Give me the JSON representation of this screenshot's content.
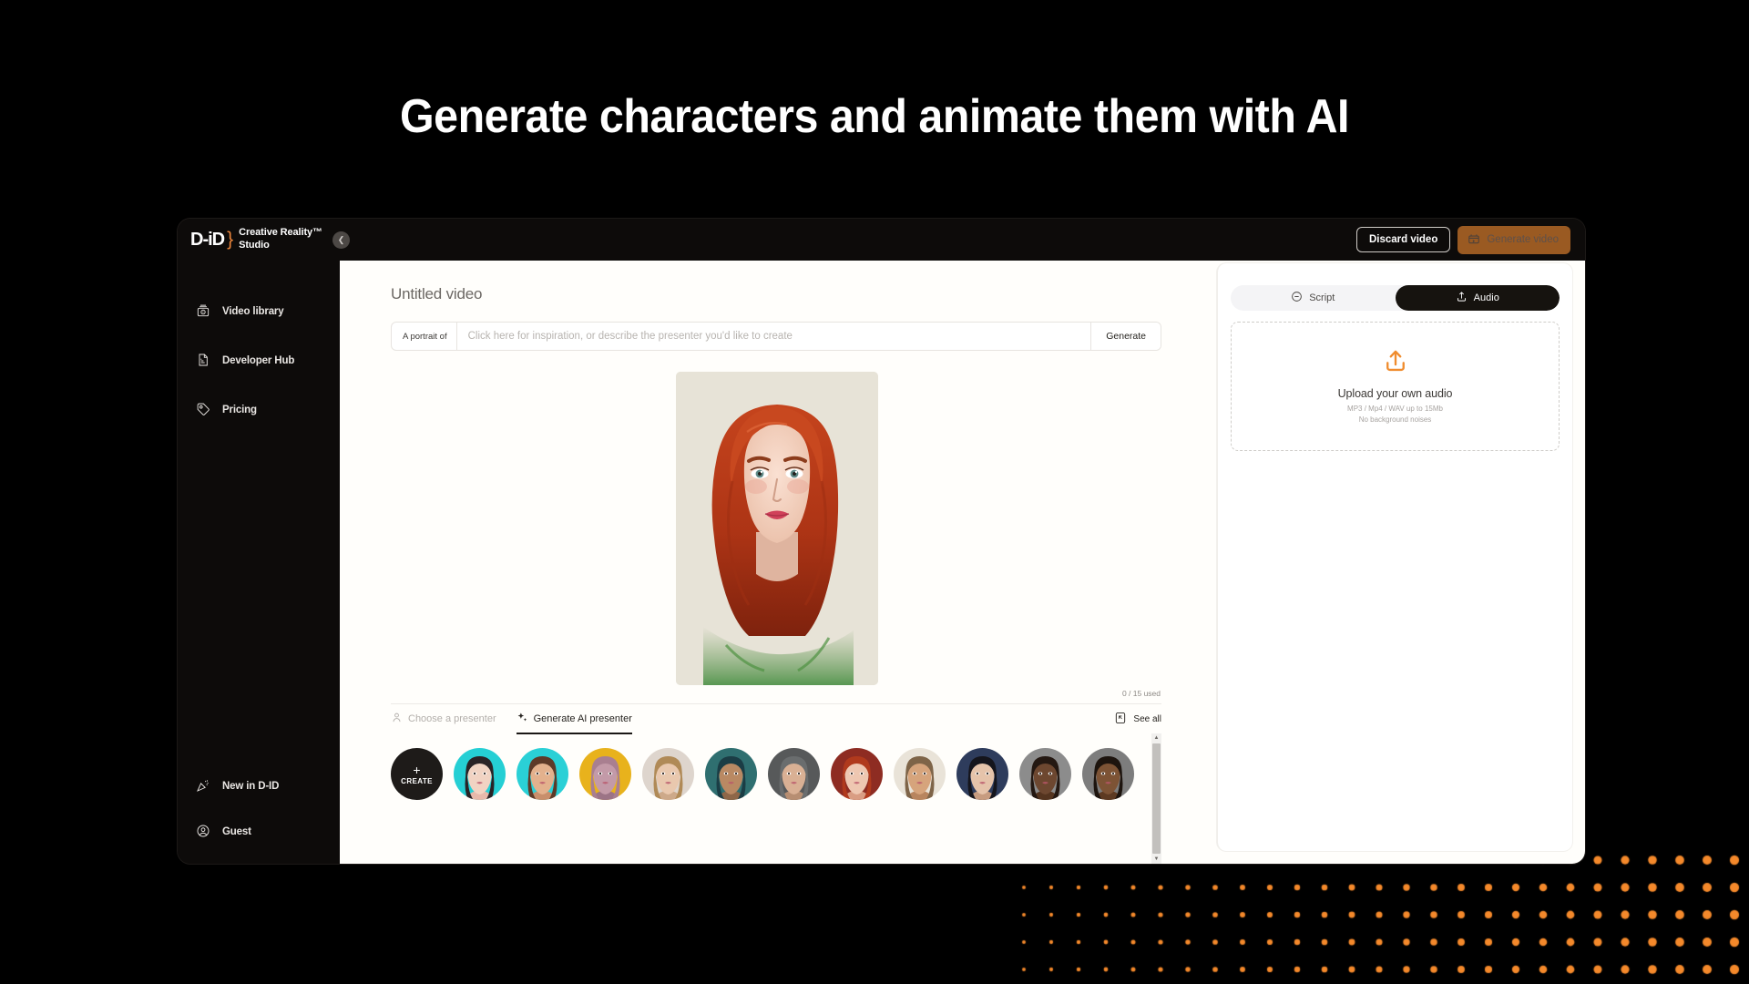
{
  "headline": "Generate characters and animate them with AI",
  "brand": {
    "logo": "D-iD",
    "title_line1": "Creative Reality™",
    "title_line2": "Studio"
  },
  "topbar": {
    "discard_label": "Discard video",
    "generate_label": "Generate video",
    "generate_icon": "video-camera-icon"
  },
  "collapse": {
    "icon": "chevron-left-icon"
  },
  "sidebar": {
    "top_items": [
      {
        "label": "Video library",
        "icon": "video-library-icon"
      },
      {
        "label": "Developer Hub",
        "icon": "document-icon"
      },
      {
        "label": "Pricing",
        "icon": "price-tag-icon"
      }
    ],
    "bottom_items": [
      {
        "label": "New in D-ID",
        "icon": "party-popper-icon"
      },
      {
        "label": "Guest",
        "icon": "user-circle-icon"
      }
    ]
  },
  "editor": {
    "video_title": "Untitled video",
    "prompt": {
      "prefix": "A portrait of",
      "value": "",
      "placeholder": "Click here for inspiration, or describe the presenter you'd like to create",
      "generate_label": "Generate"
    },
    "usage": "0 / 15 used",
    "tabs": [
      {
        "label": "Choose a presenter",
        "icon": "person-icon",
        "active": false
      },
      {
        "label": "Generate AI presenter",
        "icon": "sparkles-icon",
        "active": true
      }
    ],
    "see_all": {
      "label": "See all",
      "icon": "expand-icon"
    },
    "create_button": {
      "plus": "+",
      "label": "CREATE"
    },
    "avatars": [
      {
        "name": "avatar-woman-dark-hair",
        "bg": "#25cfd4",
        "skin": "#f1d3c3",
        "hair": "#2a2326",
        "accent": "#e7b9ab"
      },
      {
        "name": "avatar-woman-tan",
        "bg": "#2ad0d6",
        "skin": "#e3b18d",
        "hair": "#5d3a28",
        "accent": "#c88f6c"
      },
      {
        "name": "avatar-man-bald",
        "bg": "#e8b21c",
        "skin": "#c39aa8",
        "hair": "#a97f90",
        "accent": "#9c7486"
      },
      {
        "name": "avatar-man-blond",
        "bg": "#ded5cd",
        "skin": "#e9c8ae",
        "hair": "#b08a57",
        "accent": "#cda98a"
      },
      {
        "name": "avatar-woman-teal-hair",
        "bg": "#2f6f70",
        "skin": "#b98963",
        "hair": "#1b3d45",
        "accent": "#8e6748"
      },
      {
        "name": "avatar-man-glasses",
        "bg": "#57595a",
        "skin": "#d9b094",
        "hair": "#6a6d6e",
        "accent": "#b78e72"
      },
      {
        "name": "avatar-woman-red-hair",
        "bg": "#8e2c22",
        "skin": "#eec7b1",
        "hair": "#b03a1d",
        "accent": "#d99d83"
      },
      {
        "name": "avatar-woman-headscarf",
        "bg": "#e9e3d8",
        "skin": "#d6a47c",
        "hair": "#7e6448",
        "accent": "#b8855f"
      },
      {
        "name": "avatar-woman-black-hair",
        "bg": "#2e3c5c",
        "skin": "#e5c3aa",
        "hair": "#15151c",
        "accent": "#c79c80"
      },
      {
        "name": "avatar-woman-dark-skin",
        "bg": "#8c8c8c",
        "skin": "#6d4730",
        "hair": "#241812",
        "accent": "#54341f"
      },
      {
        "name": "avatar-man-dark-skin",
        "bg": "#7d7d7d",
        "skin": "#7d5335",
        "hair": "#1d140e",
        "accent": "#5d3a22"
      }
    ],
    "scrollbar": {
      "up": "▲",
      "down": "▼"
    }
  },
  "rightpanel": {
    "tabs": [
      {
        "label": "Script",
        "icon": "script-icon",
        "active": false
      },
      {
        "label": "Audio",
        "icon": "upload-icon",
        "active": true
      }
    ],
    "dropzone": {
      "icon": "upload-arrow-icon",
      "title": "Upload your own audio",
      "line1": "MP3 / Mp4 / WAV up to 15Mb",
      "line2": "No background noises"
    }
  },
  "decor": {
    "dot_color": "#f4892b"
  },
  "portrait": {
    "name": "red-haired-woman-portrait",
    "bg": "#e7e3d7",
    "hair": "#b8391b",
    "hair_dark": "#8a2a12",
    "skin": "#f2d2c2",
    "lips": "#d0415a",
    "eyes": "#5f8a87",
    "green": "#3f8a3a"
  }
}
